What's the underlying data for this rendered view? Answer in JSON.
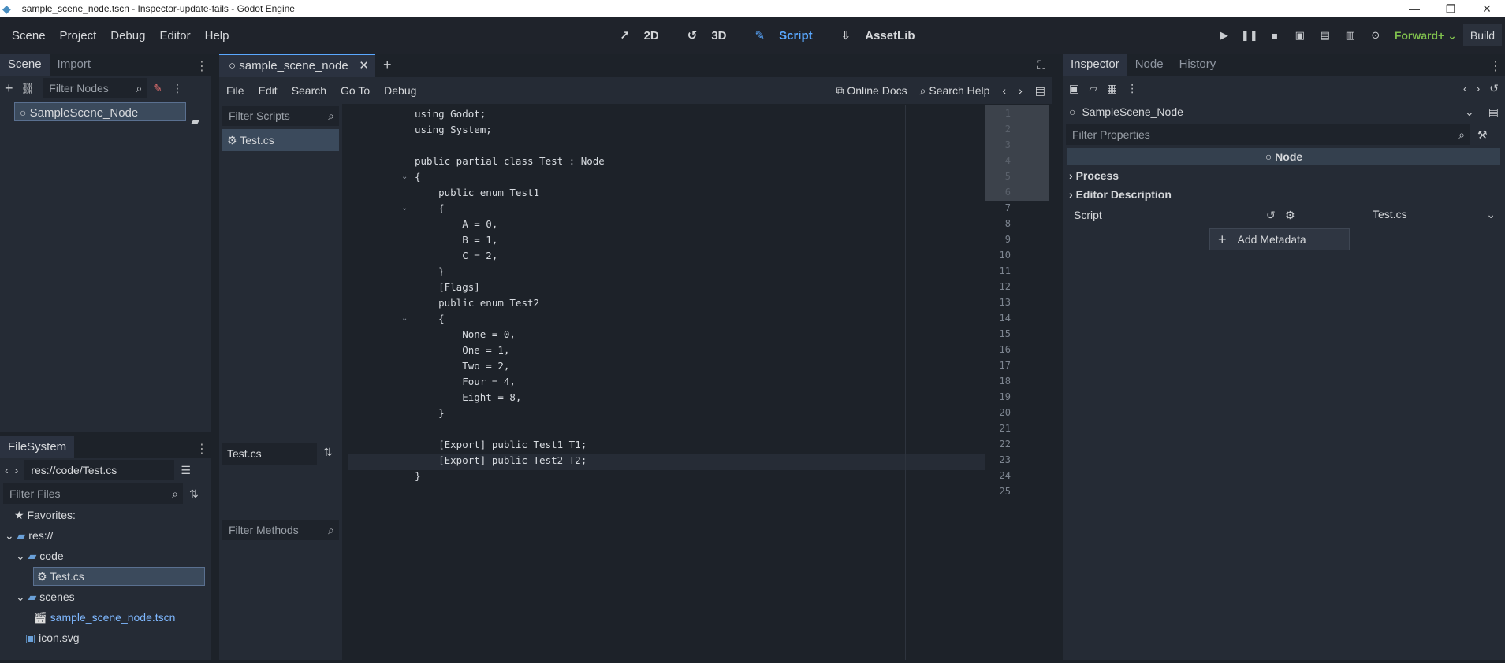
{
  "window": {
    "title": "sample_scene_node.tscn - Inspector-update-fails - Godot Engine",
    "controls": [
      "—",
      "❐",
      "✕"
    ]
  },
  "menu": [
    "Scene",
    "Project",
    "Debug",
    "Editor",
    "Help"
  ],
  "modes": [
    {
      "label": "2D",
      "icon": "2d-icon"
    },
    {
      "label": "3D",
      "icon": "3d-icon"
    },
    {
      "label": "Script",
      "icon": "script-icon",
      "active": true
    },
    {
      "label": "AssetLib",
      "icon": "assetlib-icon"
    }
  ],
  "run": {
    "renderer": "Forward+",
    "build": "Build"
  },
  "scene_dock": {
    "tabs": [
      "Scene",
      "Import"
    ],
    "filter_placeholder": "Filter Nodes",
    "root_node": "SampleScene_Node"
  },
  "filesystem": {
    "tab": "FileSystem",
    "path": "res://code/Test.cs",
    "filter_placeholder": "Filter Files",
    "items": [
      {
        "label": "Favorites:",
        "icon": "star-icon"
      },
      {
        "label": "res://",
        "icon": "folder-icon"
      },
      {
        "label": "code",
        "icon": "folder-icon"
      },
      {
        "label": "Test.cs",
        "icon": "csharp-icon",
        "selected": true
      },
      {
        "label": "scenes",
        "icon": "folder-icon"
      },
      {
        "label": "sample_scene_node.tscn",
        "icon": "scene-icon"
      },
      {
        "label": "icon.svg",
        "icon": "image-icon"
      }
    ]
  },
  "script_editor": {
    "tab": "sample_scene_node",
    "menu": [
      "File",
      "Edit",
      "Search",
      "Go To",
      "Debug"
    ],
    "online_docs": "Online Docs",
    "search_help": "Search Help",
    "filter_scripts": "Filter Scripts",
    "scripts": [
      "Test.cs"
    ],
    "current_script": "Test.cs",
    "filter_methods": "Filter Methods",
    "lines": [
      "using Godot;",
      "using System;",
      "",
      "public partial class Test : Node",
      "{",
      "    public enum Test1",
      "    {",
      "        A = 0,",
      "        B = 1,",
      "        C = 2,",
      "    }",
      "    [Flags]",
      "    public enum Test2",
      "    {",
      "        None = 0,",
      "        One = 1,",
      "        Two = 2,",
      "        Four = 4,",
      "        Eight = 8,",
      "    }",
      "",
      "    [Export] public Test1 T1;",
      "    [Export] public Test2 T2;",
      "}",
      ""
    ],
    "line_numbers": [
      "1",
      "2",
      "3",
      "4",
      "5",
      "6",
      "7",
      "8",
      "9",
      "10",
      "11",
      "12",
      "13",
      "14",
      "15",
      "16",
      "17",
      "18",
      "19",
      "20",
      "21",
      "22",
      "23",
      "24",
      "25"
    ],
    "current_line": 23
  },
  "inspector": {
    "tabs": [
      "Inspector",
      "Node",
      "History"
    ],
    "object": "SampleScene_Node",
    "filter_placeholder": "Filter Properties",
    "class": "Node",
    "sections": [
      "Process",
      "Editor Description"
    ],
    "script_label": "Script",
    "script_value": "Test.cs",
    "add_metadata": "Add Metadata"
  }
}
